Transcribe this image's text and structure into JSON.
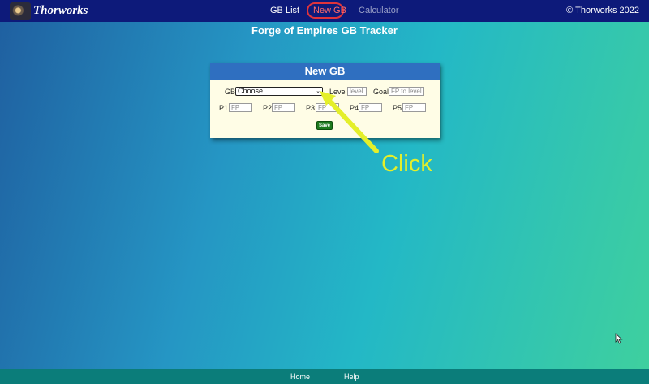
{
  "brand": {
    "name": "Thorworks"
  },
  "nav": {
    "items": [
      {
        "label": "GB List"
      },
      {
        "label": "New GB"
      },
      {
        "label": "Calculator"
      }
    ],
    "copyright": "© Thorworks 2022"
  },
  "page": {
    "title": "Forge of Empires GB Tracker"
  },
  "form": {
    "title": "New GB",
    "gb_label": "GB",
    "gb_select_value": "Choose",
    "level_label": "Level",
    "level_placeholder": "level",
    "goal_label": "Goal",
    "goal_placeholder": "FP to level",
    "positions": [
      {
        "label": "P1",
        "placeholder": "FP"
      },
      {
        "label": "P2",
        "placeholder": "FP"
      },
      {
        "label": "P3",
        "placeholder": "FP"
      },
      {
        "label": "P4",
        "placeholder": "FP"
      },
      {
        "label": "P5",
        "placeholder": "FP"
      }
    ],
    "save_label": "Save"
  },
  "annotation": {
    "text": "Click",
    "color": "#e4ef2a"
  },
  "footer": {
    "links": [
      {
        "label": "Home"
      },
      {
        "label": "Help"
      }
    ]
  },
  "colors": {
    "nav_bg": "#0d1a7a",
    "card_header": "#2f6fc0",
    "card_body": "#fffde6",
    "save_button": "#1d7a1d",
    "footer_bg": "#0b7d7a",
    "active_nav": "#ff6b6b"
  }
}
